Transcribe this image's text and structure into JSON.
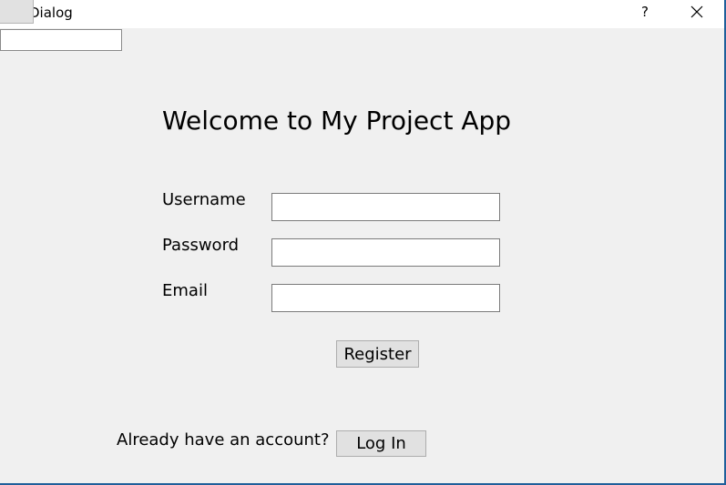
{
  "window": {
    "title": "Dialog",
    "help_label": "?"
  },
  "form": {
    "heading": "Welcome to My Project App",
    "username_label": "Username",
    "password_label": "Password",
    "email_label": "Email",
    "username_value": "",
    "password_value": "",
    "email_value": "",
    "register_label": "Register"
  },
  "footer": {
    "prompt": "Already have an account?",
    "login_label": "Log In"
  },
  "colors": {
    "window_bg": "#f0f0f0",
    "titlebar_bg": "#ffffff",
    "button_bg": "#e1e1e1",
    "border_accent": "#1f5f9a"
  }
}
